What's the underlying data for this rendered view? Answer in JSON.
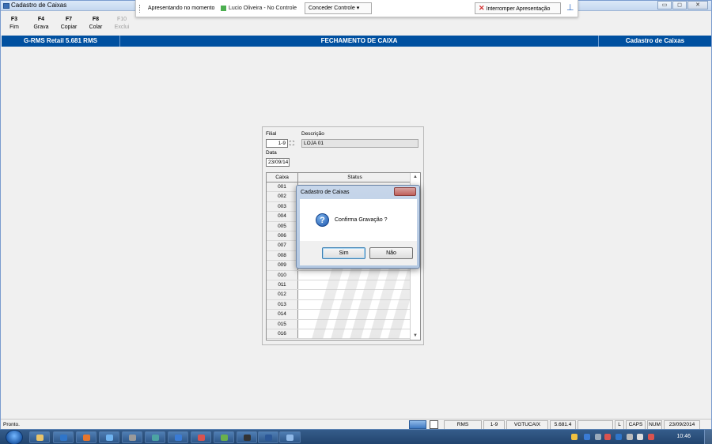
{
  "window": {
    "title": "Cadastro de Caixas"
  },
  "presenting": {
    "label": "Apresentando no momento",
    "presenter": "Lucio Oliveira - No Controle",
    "give_control": "Conceder Controle ▾",
    "stop": "Interromper Apresentação"
  },
  "toolbar": [
    {
      "key": "F3",
      "action": "Fim",
      "enabled": true
    },
    {
      "key": "F4",
      "action": "Grava",
      "enabled": true
    },
    {
      "key": "F7",
      "action": "Copiar",
      "enabled": true
    },
    {
      "key": "F8",
      "action": "Colar",
      "enabled": true
    },
    {
      "key": "F10",
      "action": "Exclui",
      "enabled": false
    }
  ],
  "header": {
    "left": "G-RMS Retail 5.681 RMS",
    "center": "FECHAMENTO DE CAIXA",
    "right": "Cadastro de Caixas"
  },
  "form": {
    "filial_label": "Filial",
    "filial_value": "1-9",
    "descricao_label": "Descrição",
    "descricao_value": "LOJA 01",
    "data_label": "Data",
    "data_value": "23/09/14"
  },
  "grid": {
    "columns": [
      "Caixa",
      "Status"
    ],
    "rows": [
      "001",
      "002",
      "003",
      "004",
      "005",
      "006",
      "007",
      "008",
      "009",
      "010",
      "011",
      "012",
      "013",
      "014",
      "015",
      "016"
    ]
  },
  "dialog": {
    "title": "Cadastro de Caixas",
    "message": "Confirma Gravação ?",
    "yes": "Sim",
    "no": "Não"
  },
  "status": {
    "message": "Pronto.",
    "panels": [
      "RMS",
      "1-9",
      "VGTUCAIX",
      "5.681.4",
      "",
      "L",
      "CAPS",
      "NUM",
      "23/09/2014"
    ]
  },
  "taskbar": {
    "clock": "10:46"
  },
  "colors": {
    "header_blue": "#0050a0",
    "taskbar": "#2a4d7a"
  }
}
